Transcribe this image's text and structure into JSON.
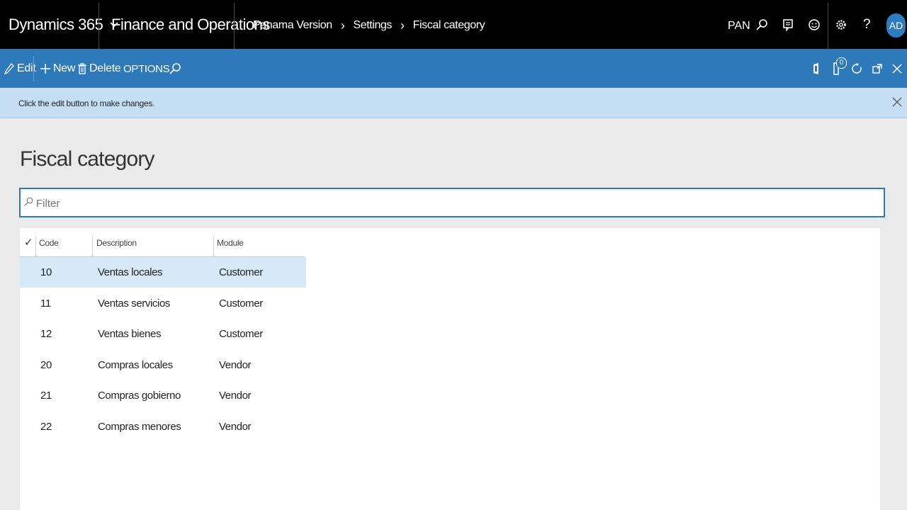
{
  "topbar": {
    "product": "Dynamics 365",
    "app": "Finance and Operations",
    "breadcrumb": [
      "Panama Version",
      "Settings",
      "Fiscal category"
    ],
    "company": "PAN",
    "user_initials": "AD",
    "icons": [
      "search-icon",
      "messages-icon",
      "feedback-smiley-icon",
      "settings-gear-icon",
      "help-icon"
    ]
  },
  "actionbar": {
    "edit_label": "Edit",
    "new_label": "New",
    "delete_label": "Delete",
    "options_label": "OPTIONS",
    "notification_count": "0",
    "icons": [
      "search-icon",
      "office-icon",
      "notification-icon",
      "refresh-icon",
      "open-new-window-icon",
      "close-icon"
    ]
  },
  "message": {
    "text": "Click the edit button to make changes."
  },
  "page": {
    "title": "Fiscal category",
    "filter_placeholder": "Filter"
  },
  "grid": {
    "columns": [
      "Code",
      "Description",
      "Module"
    ],
    "rows": [
      {
        "code": "10",
        "description": "Ventas locales",
        "module": "Customer",
        "selected": true
      },
      {
        "code": "11",
        "description": "Ventas servicios",
        "module": "Customer",
        "selected": false
      },
      {
        "code": "12",
        "description": "Ventas bienes",
        "module": "Customer",
        "selected": false
      },
      {
        "code": "20",
        "description": "Compras locales",
        "module": "Vendor",
        "selected": false
      },
      {
        "code": "21",
        "description": "Compras gobierno",
        "module": "Vendor",
        "selected": false
      },
      {
        "code": "22",
        "description": "Compras menores",
        "module": "Vendor",
        "selected": false
      }
    ]
  },
  "colors": {
    "topbar": "#000000",
    "actionbar": "#2e79b9",
    "message_bar": "#c6def3",
    "selected_row": "#d7e8f8",
    "page_background": "#eaeaea"
  }
}
